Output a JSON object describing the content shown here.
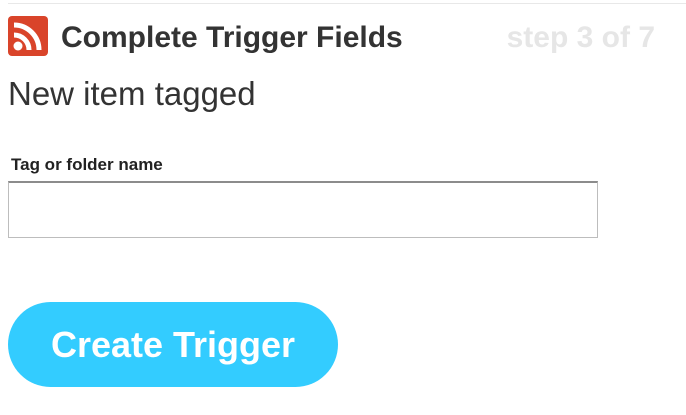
{
  "header": {
    "icon": "rss-feed-icon",
    "icon_color": "#d9442a",
    "title": "Complete Trigger Fields",
    "step": "step 3 of 7"
  },
  "trigger": {
    "name": "New item tagged"
  },
  "form": {
    "tag_field": {
      "label": "Tag or folder name",
      "value": "",
      "placeholder": ""
    }
  },
  "actions": {
    "create_label": "Create Trigger",
    "create_color": "#33ccff"
  }
}
